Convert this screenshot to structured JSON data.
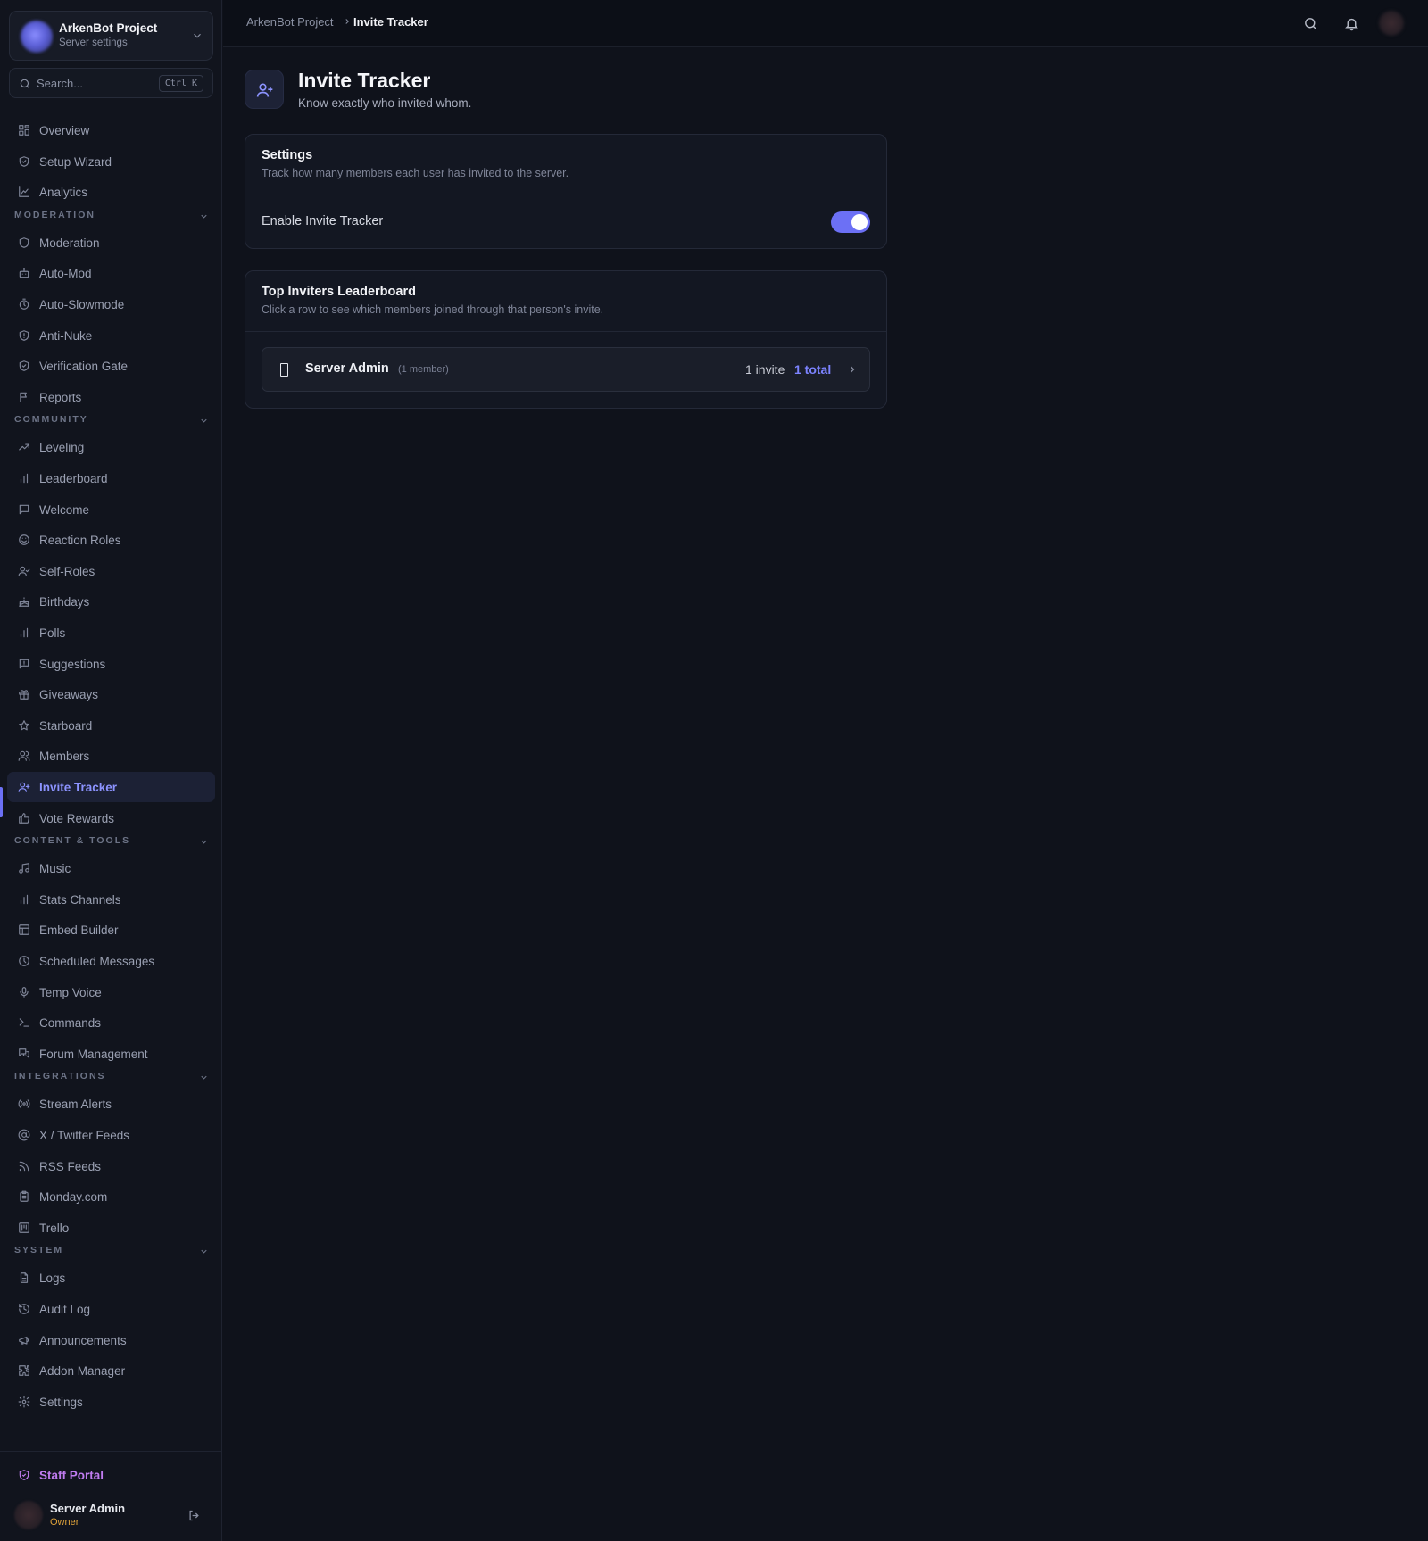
{
  "server": {
    "name": "ArkenBot Project",
    "subtitle": "Server settings"
  },
  "search": {
    "placeholder": "Search...",
    "shortcut": "Ctrl K"
  },
  "nav": {
    "top": [
      {
        "label": "Overview",
        "icon": "grid-icon"
      },
      {
        "label": "Setup Wizard",
        "icon": "shield-check-icon"
      },
      {
        "label": "Analytics",
        "icon": "chart-line-icon"
      }
    ],
    "sections": [
      {
        "title": "MODERATION",
        "items": [
          {
            "label": "Moderation",
            "icon": "shield-icon"
          },
          {
            "label": "Auto-Mod",
            "icon": "robot-icon"
          },
          {
            "label": "Auto-Slowmode",
            "icon": "timer-icon"
          },
          {
            "label": "Anti-Nuke",
            "icon": "shield-alert-icon"
          },
          {
            "label": "Verification Gate",
            "icon": "shield-check-icon"
          },
          {
            "label": "Reports",
            "icon": "flag-icon"
          }
        ]
      },
      {
        "title": "COMMUNITY",
        "items": [
          {
            "label": "Leveling",
            "icon": "trending-up-icon"
          },
          {
            "label": "Leaderboard",
            "icon": "bar-chart-icon"
          },
          {
            "label": "Welcome",
            "icon": "message-icon"
          },
          {
            "label": "Reaction Roles",
            "icon": "smile-icon"
          },
          {
            "label": "Self-Roles",
            "icon": "user-check-icon"
          },
          {
            "label": "Birthdays",
            "icon": "cake-icon"
          },
          {
            "label": "Polls",
            "icon": "bar-chart-icon"
          },
          {
            "label": "Suggestions",
            "icon": "message-alert-icon"
          },
          {
            "label": "Giveaways",
            "icon": "gift-icon"
          },
          {
            "label": "Starboard",
            "icon": "star-icon"
          },
          {
            "label": "Members",
            "icon": "users-icon"
          },
          {
            "label": "Invite Tracker",
            "icon": "user-plus-icon"
          },
          {
            "label": "Vote Rewards",
            "icon": "thumbs-up-icon"
          }
        ]
      },
      {
        "title": "CONTENT & TOOLS",
        "items": [
          {
            "label": "Music",
            "icon": "music-icon"
          },
          {
            "label": "Stats Channels",
            "icon": "bar-chart-icon"
          },
          {
            "label": "Embed Builder",
            "icon": "layout-icon"
          },
          {
            "label": "Scheduled Messages",
            "icon": "clock-icon"
          },
          {
            "label": "Temp Voice",
            "icon": "mic-icon"
          },
          {
            "label": "Commands",
            "icon": "terminal-icon"
          },
          {
            "label": "Forum Management",
            "icon": "messages-icon"
          }
        ]
      },
      {
        "title": "INTEGRATIONS",
        "items": [
          {
            "label": "Stream Alerts",
            "icon": "radio-icon"
          },
          {
            "label": "X / Twitter Feeds",
            "icon": "at-sign-icon"
          },
          {
            "label": "RSS Feeds",
            "icon": "rss-icon"
          },
          {
            "label": "Monday.com",
            "icon": "clipboard-icon"
          },
          {
            "label": "Trello",
            "icon": "kanban-icon"
          }
        ]
      },
      {
        "title": "SYSTEM",
        "items": [
          {
            "label": "Logs",
            "icon": "file-text-icon"
          },
          {
            "label": "Audit Log",
            "icon": "history-icon"
          },
          {
            "label": "Announcements",
            "icon": "megaphone-icon"
          },
          {
            "label": "Addon Manager",
            "icon": "puzzle-icon"
          },
          {
            "label": "Settings",
            "icon": "gear-icon"
          }
        ]
      }
    ],
    "active": "Invite Tracker"
  },
  "footer": {
    "staff_portal": "Staff Portal",
    "user_name": "Server Admin",
    "user_role": "Owner"
  },
  "breadcrumb": {
    "root": "ArkenBot Project",
    "current": "Invite Tracker"
  },
  "page": {
    "title": "Invite Tracker",
    "subtitle": "Know exactly who invited whom."
  },
  "settings_card": {
    "title": "Settings",
    "subtitle": "Track how many members each user has invited to the server.",
    "toggle_label": "Enable Invite Tracker",
    "toggle_on": true
  },
  "leaderboard_card": {
    "title": "Top Inviters Leaderboard",
    "subtitle": "Click a row to see which members joined through that person's invite.",
    "rows": [
      {
        "name": "Server Admin",
        "members": "(1 member)",
        "invites": "1 invite",
        "total": "1 total"
      }
    ]
  },
  "colors": {
    "accent": "#6c70f5",
    "accent_text": "#7c83ff",
    "staff": "#c07cf0",
    "owner": "#e0a33a",
    "background": "#0f121b"
  }
}
